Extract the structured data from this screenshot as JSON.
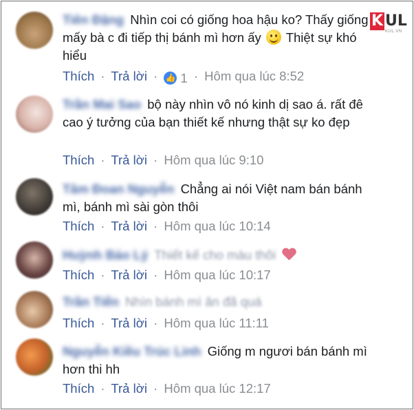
{
  "watermark": {
    "brand_k": "K",
    "brand_ul": "UL",
    "brand_sub": "KUL.VN"
  },
  "actions": {
    "like": "Thích",
    "reply": "Trả lời",
    "separator": "·"
  },
  "comments": [
    {
      "avatar_color": "#9a7548",
      "name": "Tiên Đặng",
      "text": "Nhìn coi có giống hoa hậu ko? Thấy giống mấy bà c đi tiếp thị bánh mì hơn ấy",
      "text_after_emoji": "Thiệt sự khó hiểu",
      "reaction_count": "1",
      "time": "Hôm qua lúc 8:52"
    },
    {
      "avatar_color": "#d8b3aa",
      "name": "Trần Mai Sao",
      "text": "bộ này nhìn vô nó kinh dị sao á. rất đê cao ý tưởng của bạn thiết kế nhưng thật sự ko đẹp",
      "time": "Hôm qua lúc 9:10"
    },
    {
      "avatar_color": "#3f3a36",
      "name": "Tâm Đoan Nguyễn",
      "text": "Chẳng ai nói Việt nam bán bánh mì, bánh mì sài gòn thôi",
      "time": "Hôm qua lúc 10:14"
    },
    {
      "avatar_color": "#6e4a48",
      "name": "Huỳnh Bảo Lý",
      "text": "Thiết kế cho màu thôi",
      "time": "Hôm qua lúc 10:17"
    },
    {
      "avatar_color": "#a87a58",
      "name": "Trần Tiến",
      "text": "Nhìn bánh mì ăn đã quá",
      "time": "Hôm qua lúc 11:11"
    },
    {
      "avatar_color": "#c8642c",
      "name": "Nguyễn Kiều Trúc Linh",
      "text": "Giống m ngươi bán bánh mì hơn thi hh",
      "time": "Hôm qua lúc 12:17"
    }
  ]
}
